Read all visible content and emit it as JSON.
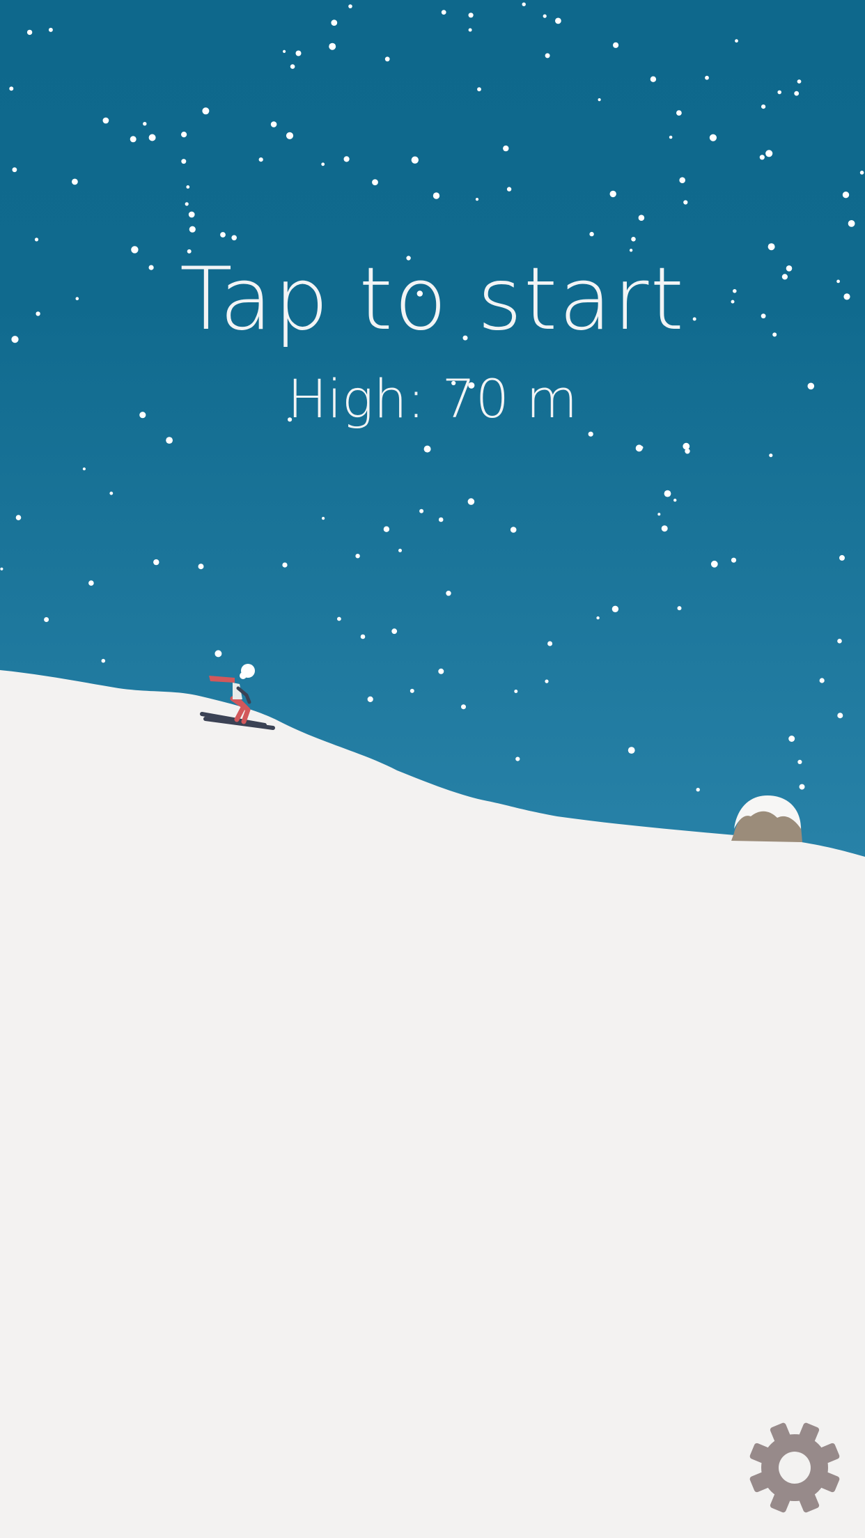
{
  "screen": {
    "prompt_text": "Tap to start",
    "high_score_text": "High: 70 m"
  },
  "colors": {
    "sky_top": "#0e688c",
    "sky_bottom": "#2882a8",
    "snow": "#f3f2f1",
    "text": "#f2f4f5",
    "snowflake": "#ffffff",
    "gear": "#978a8a",
    "rock": "#9b8c7a",
    "skier_scarf": "#d2585b",
    "skier_skis": "#3b4254"
  },
  "icons": {
    "settings": "gear-icon"
  }
}
